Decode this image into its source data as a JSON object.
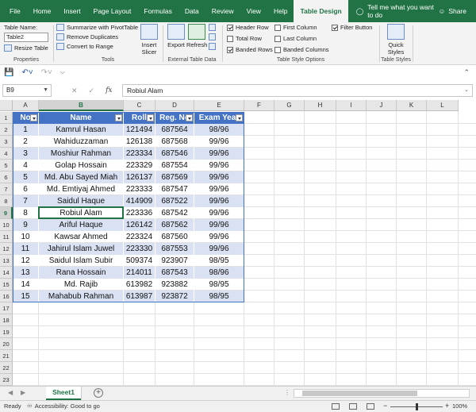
{
  "menu": {
    "tabs": [
      "File",
      "Home",
      "Insert",
      "Page Layout",
      "Formulas",
      "Data",
      "Review",
      "View",
      "Help",
      "Table Design"
    ],
    "active_tab": "Table Design",
    "tell_me": "Tell me what you want to do",
    "share": "Share"
  },
  "ribbon": {
    "properties": {
      "table_name_label": "Table Name:",
      "table_name_value": "Table2",
      "resize_table": "Resize Table",
      "group_label": "Properties"
    },
    "tools": {
      "summarize": "Summarize with PivotTable",
      "remove_duplicates": "Remove Duplicates",
      "convert_to_range": "Convert to Range",
      "insert_slicer_1": "Insert",
      "insert_slicer_2": "Slicer",
      "group_label": "Tools"
    },
    "external": {
      "export": "Export",
      "refresh": "Refresh",
      "group_label": "External Table Data"
    },
    "style_options": {
      "header_row": "Header Row",
      "header_row_checked": true,
      "total_row": "Total Row",
      "total_row_checked": false,
      "banded_rows": "Banded Rows",
      "banded_rows_checked": true,
      "first_column": "First Column",
      "first_column_checked": false,
      "last_column": "Last Column",
      "last_column_checked": false,
      "banded_columns": "Banded Columns",
      "banded_columns_checked": false,
      "filter_button": "Filter Button",
      "filter_button_checked": true,
      "group_label": "Table Style Options"
    },
    "styles": {
      "quick_1": "Quick",
      "quick_2": "Styles",
      "group_label": "Table Styles"
    }
  },
  "formula_bar": {
    "name_box": "B9",
    "formula": "Robiul Alam"
  },
  "grid": {
    "columns": [
      "A",
      "B",
      "C",
      "D",
      "E",
      "F",
      "G",
      "H",
      "I",
      "J",
      "K",
      "L"
    ],
    "selected_column": "B",
    "row_numbers": [
      "1",
      "2",
      "3",
      "4",
      "5",
      "6",
      "7",
      "8",
      "9",
      "10",
      "11",
      "12",
      "13",
      "14",
      "15",
      "16",
      "17",
      "18",
      "19",
      "20",
      "21",
      "22",
      "23"
    ],
    "selected_row": "9",
    "selected_cell": "B9"
  },
  "table": {
    "headers": [
      "No",
      "Name",
      "Roll",
      "Reg. No",
      "Exam Year"
    ],
    "rows": [
      [
        "1",
        "Kamrul Hasan",
        "121494",
        "687564",
        "98/96"
      ],
      [
        "2",
        "Wahiduzzaman",
        "126138",
        "687568",
        "99/96"
      ],
      [
        "3",
        "Moshiur Rahman",
        "223334",
        "687546",
        "99/96"
      ],
      [
        "4",
        "Golap Hossain",
        "223329",
        "687554",
        "99/96"
      ],
      [
        "5",
        "Md. Abu Sayed Miah",
        "126137",
        "687569",
        "99/96"
      ],
      [
        "6",
        "Md. Emtiyaj Ahmed",
        "223333",
        "687547",
        "99/96"
      ],
      [
        "7",
        "Saidul Haque",
        "414909",
        "687522",
        "99/96"
      ],
      [
        "8",
        "Robiul Alam",
        "223336",
        "687542",
        "99/96"
      ],
      [
        "9",
        "Ariful Haque",
        "126142",
        "687562",
        "99/96"
      ],
      [
        "10",
        "Kawsar Ahmed",
        "223324",
        "687560",
        "99/96"
      ],
      [
        "11",
        "Jahirul Islam Juwel",
        "223330",
        "687553",
        "99/96"
      ],
      [
        "12",
        "Saidul Islam Subir",
        "509374",
        "923907",
        "98/95"
      ],
      [
        "13",
        "Rana Hossain",
        "214011",
        "687543",
        "98/96"
      ],
      [
        "14",
        "Md. Rajib",
        "613982",
        "923882",
        "98/95"
      ],
      [
        "15",
        "Mahabub Rahman",
        "613987",
        "923872",
        "98/95"
      ]
    ]
  },
  "sheets": {
    "active": "Sheet1"
  },
  "status": {
    "ready": "Ready",
    "accessibility": "Accessibility: Good to go",
    "zoom": "100%"
  },
  "colors": {
    "brand_green": "#217346",
    "table_header": "#4472c4",
    "band": "#d9e1f2"
  }
}
